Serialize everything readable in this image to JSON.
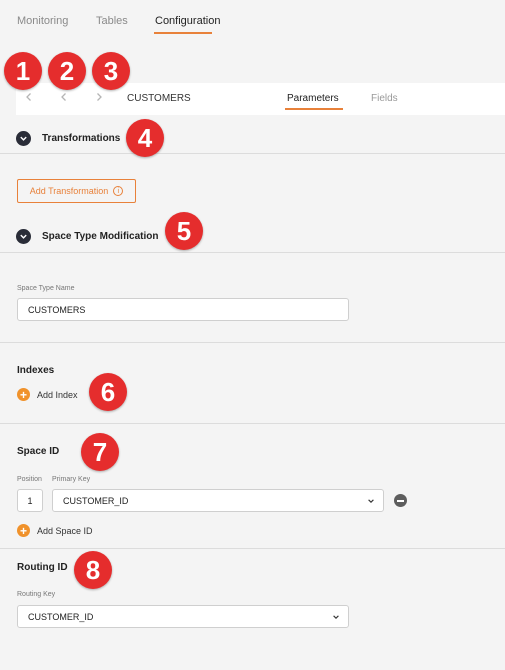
{
  "topnav": {
    "tabs": [
      {
        "label": "Monitoring"
      },
      {
        "label": "Tables"
      },
      {
        "label": "Configuration",
        "active": true
      }
    ]
  },
  "subbar": {
    "nav_icons": [
      "chevron-left-icon",
      "chevron-left-icon",
      "chevron-right-icon"
    ],
    "entity": "CUSTOMERS",
    "tabs": [
      {
        "label": "Parameters",
        "active": true
      },
      {
        "label": "Fields"
      }
    ]
  },
  "transformations": {
    "title": "Transformations",
    "add_button": "Add Transformation",
    "info_glyph": "i"
  },
  "space_type": {
    "title": "Space Type Modification",
    "name_label": "Space Type Name",
    "name_value": "CUSTOMERS"
  },
  "indexes": {
    "title": "Indexes",
    "add_label": "Add Index"
  },
  "space_id": {
    "title": "Space ID",
    "position_label": "Position",
    "primary_key_label": "Primary Key",
    "position_value": "1",
    "primary_key_value": "CUSTOMER_ID",
    "add_label": "Add Space ID"
  },
  "routing_id": {
    "title": "Routing ID",
    "routing_key_label": "Routing Key",
    "routing_key_value": "CUSTOMER_ID"
  },
  "badges": [
    "1",
    "2",
    "3",
    "4",
    "5",
    "6",
    "7",
    "8"
  ],
  "colors": {
    "accent": "#e8813a",
    "badge": "#e52d2d",
    "plus": "#f0922b",
    "chevron_circle": "#2a2d38"
  }
}
